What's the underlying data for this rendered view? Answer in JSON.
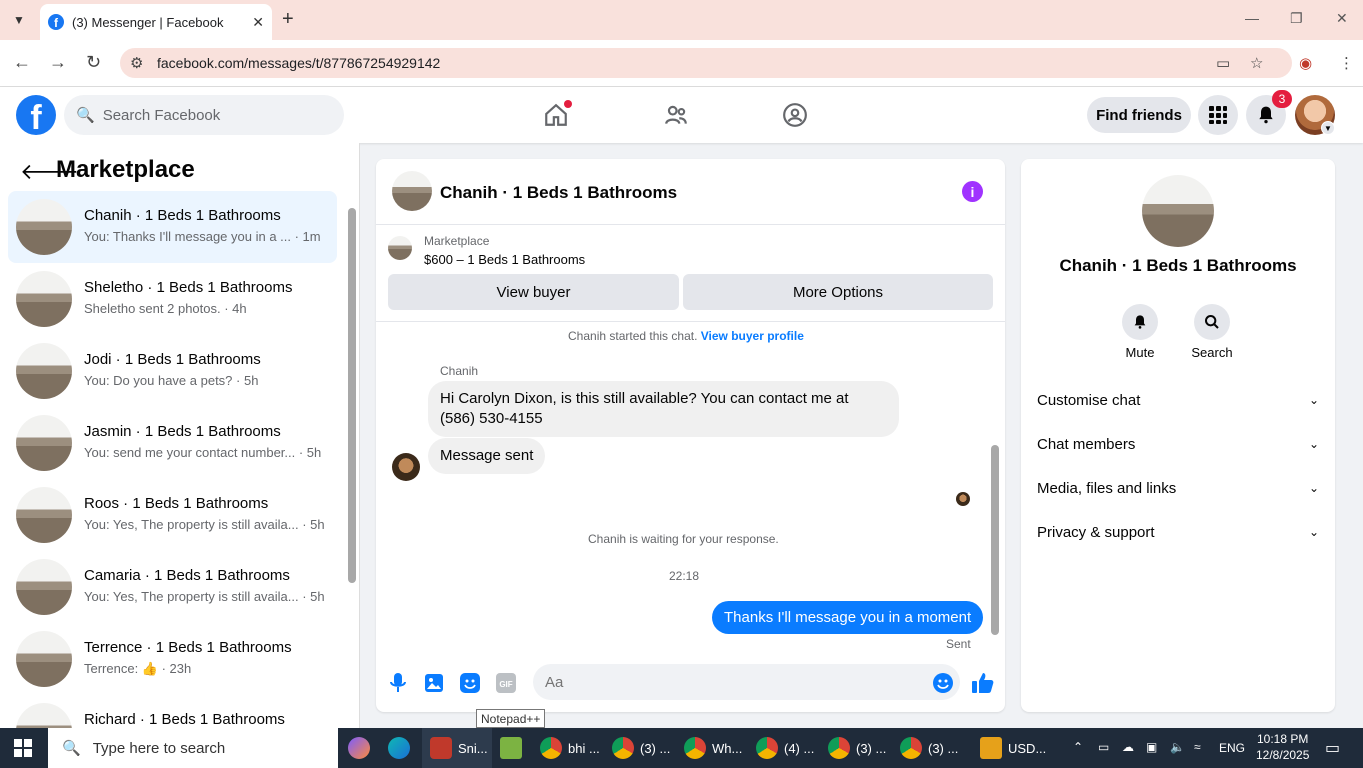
{
  "browser": {
    "tab_title": "(3) Messenger | Facebook",
    "url": "facebook.com/messages/t/877867254929142"
  },
  "header": {
    "search_placeholder": "Search Facebook",
    "find_friends": "Find friends",
    "notification_count": "3"
  },
  "sidebar": {
    "title": "Marketplace",
    "conversations": [
      {
        "name": "Chanih · 1 Beds 1 Bathrooms",
        "snippet": "You: Thanks I'll message you in a ... · 1m"
      },
      {
        "name": "Sheletho · 1 Beds 1 Bathrooms",
        "snippet": "Sheletho sent 2 photos. · 4h"
      },
      {
        "name": "Jodi · 1 Beds 1 Bathrooms",
        "snippet": "You: Do you have a pets? · 5h"
      },
      {
        "name": "Jasmin · 1 Beds 1 Bathrooms",
        "snippet": "You: send me your contact number... · 5h"
      },
      {
        "name": "Roos · 1 Beds 1 Bathrooms",
        "snippet": "You: Yes, The property is still availa... · 5h"
      },
      {
        "name": "Camaria · 1 Beds 1 Bathrooms",
        "snippet": "You: Yes, The property is still availa... · 5h"
      },
      {
        "name": "Terrence · 1 Beds 1 Bathrooms",
        "snippet": "Terrence: 👍 · 23h"
      },
      {
        "name": "Richard · 1 Beds 1 Bathrooms",
        "snippet": ""
      }
    ]
  },
  "chat": {
    "title": "Chanih · 1 Beds 1 Bathrooms",
    "listing_source": "Marketplace",
    "listing_desc": "$600 – 1 Beds 1 Bathrooms",
    "view_buyer": "View buyer",
    "more_options": "More Options",
    "started_text": "Chanih started this chat.",
    "view_profile": "View buyer profile",
    "sender": "Chanih",
    "msg1": "Hi Carolyn Dixon, is this still available? You can contact me at (586) 530-4155",
    "msg2": "Message sent",
    "waiting": "Chanih is waiting for your response.",
    "time": "22:18",
    "reply": "Thanks I'll message you in a moment",
    "sent": "Sent",
    "composer_placeholder": "Aa",
    "tooltip": "Notepad++"
  },
  "details": {
    "title": "Chanih · 1 Beds 1 Bathrooms",
    "mute": "Mute",
    "search": "Search",
    "rows": [
      "Customise chat",
      "Chat members",
      "Media, files and links",
      "Privacy & support"
    ]
  },
  "taskbar": {
    "search_placeholder": "Type here to search",
    "apps": [
      "Sni...",
      "",
      "bhi ...",
      "(3) ...",
      "Wh...",
      "(4) ...",
      "(3) ...",
      "(3) ..."
    ],
    "currency": "USD...",
    "lang": "ENG",
    "time": "10:18 PM",
    "date": "12/8/2025"
  }
}
